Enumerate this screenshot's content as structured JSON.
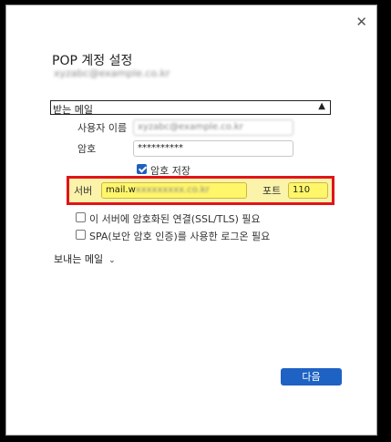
{
  "dialog": {
    "close_label": "✕",
    "title": "POP 계정 설정",
    "account_email": "xyzabc@example.co.kr"
  },
  "incoming": {
    "header": "받는 메일",
    "username_label": "사용자 이름",
    "username_value": "xyzabc@example.co.kr",
    "password_label": "암호",
    "password_value": "**********",
    "save_password_label": "암호 저장",
    "save_password_checked": true,
    "server_label": "서버",
    "server_value_visible": "mail.w",
    "server_value_hidden": "xxxxxxxxx.co.kr",
    "port_label": "포트",
    "port_value": "110",
    "ssl_label": "이 서버에 암호화된 연결(SSL/TLS) 필요",
    "ssl_checked": false,
    "spa_label": "SPA(보안 암호 인증)를 사용한 로그온 필요",
    "spa_checked": false
  },
  "outgoing": {
    "header": "보내는 메일"
  },
  "footer": {
    "next_label": "다음"
  },
  "colors": {
    "accent": "#1e62c4",
    "highlight_border": "#e0141a",
    "highlight_fill": "#fff66a"
  }
}
